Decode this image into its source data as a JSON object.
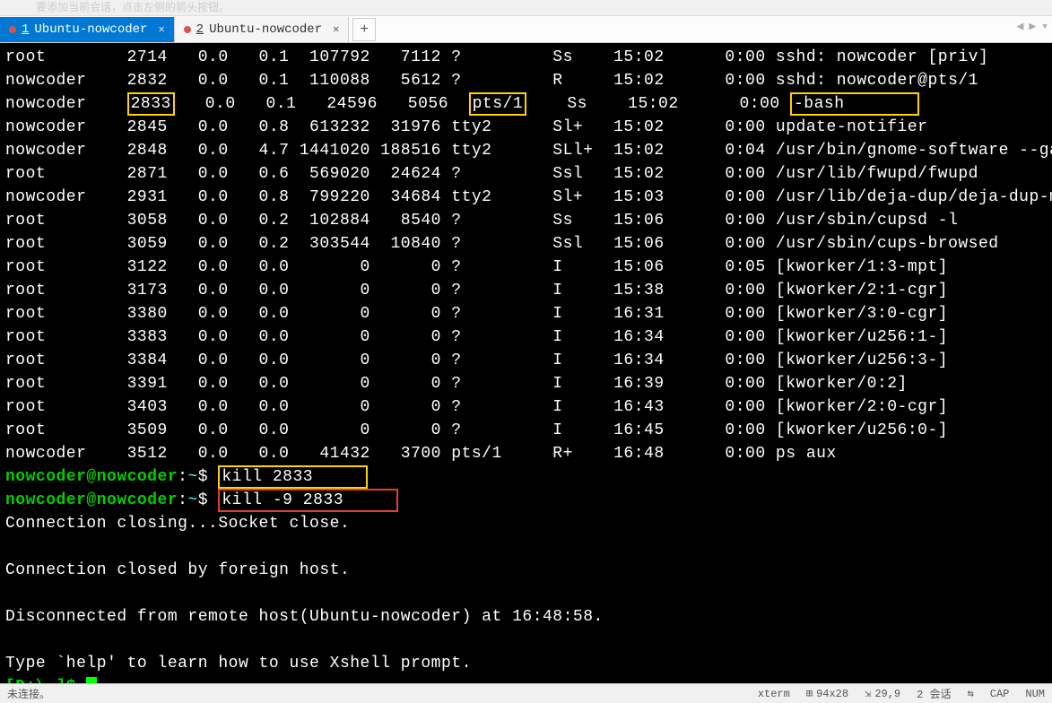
{
  "hint_text": "要添加当前会话，点击左侧的箭头按钮。",
  "tabs": [
    {
      "num": "1",
      "label": "Ubuntu-nowcoder",
      "active": true
    },
    {
      "num": "2",
      "label": "Ubuntu-nowcoder",
      "active": false
    }
  ],
  "addtab": "+",
  "process_rows": [
    {
      "user": "root",
      "pid": "2714",
      "cpu": "0.0",
      "mem": "0.1",
      "vsz": "107792",
      "rss": "7112",
      "tty": "?",
      "stat": "Ss",
      "start": "15:02",
      "time": "0:00",
      "cmd": "sshd: nowcoder [priv]"
    },
    {
      "user": "nowcoder",
      "pid": "2832",
      "cpu": "0.0",
      "mem": "0.1",
      "vsz": "110088",
      "rss": "5612",
      "tty": "?",
      "stat": "R",
      "start": "15:02",
      "time": "0:00",
      "cmd": "sshd: nowcoder@pts/1"
    },
    {
      "user": "nowcoder",
      "pid": "2833",
      "cpu": "0.0",
      "mem": "0.1",
      "vsz": "24596",
      "rss": "5056",
      "tty": "pts/1",
      "stat": "Ss",
      "start": "15:02",
      "time": "0:00",
      "cmd": "-bash",
      "hl_pid": true,
      "hl_tty": true,
      "hl_cmd": true
    },
    {
      "user": "nowcoder",
      "pid": "2845",
      "cpu": "0.0",
      "mem": "0.8",
      "vsz": "613232",
      "rss": "31976",
      "tty": "tty2",
      "stat": "Sl+",
      "start": "15:02",
      "time": "0:00",
      "cmd": "update-notifier"
    },
    {
      "user": "nowcoder",
      "pid": "2848",
      "cpu": "0.0",
      "mem": "4.7",
      "vsz": "1441020",
      "rss": "188516",
      "tty": "tty2",
      "stat": "SLl+",
      "start": "15:02",
      "time": "0:04",
      "cmd": "/usr/bin/gnome-software --ga"
    },
    {
      "user": "root",
      "pid": "2871",
      "cpu": "0.0",
      "mem": "0.6",
      "vsz": "569020",
      "rss": "24624",
      "tty": "?",
      "stat": "Ssl",
      "start": "15:02",
      "time": "0:00",
      "cmd": "/usr/lib/fwupd/fwupd"
    },
    {
      "user": "nowcoder",
      "pid": "2931",
      "cpu": "0.0",
      "mem": "0.8",
      "vsz": "799220",
      "rss": "34684",
      "tty": "tty2",
      "stat": "Sl+",
      "start": "15:03",
      "time": "0:00",
      "cmd": "/usr/lib/deja-dup/deja-dup-m"
    },
    {
      "user": "root",
      "pid": "3058",
      "cpu": "0.0",
      "mem": "0.2",
      "vsz": "102884",
      "rss": "8540",
      "tty": "?",
      "stat": "Ss",
      "start": "15:06",
      "time": "0:00",
      "cmd": "/usr/sbin/cupsd -l"
    },
    {
      "user": "root",
      "pid": "3059",
      "cpu": "0.0",
      "mem": "0.2",
      "vsz": "303544",
      "rss": "10840",
      "tty": "?",
      "stat": "Ssl",
      "start": "15:06",
      "time": "0:00",
      "cmd": "/usr/sbin/cups-browsed"
    },
    {
      "user": "root",
      "pid": "3122",
      "cpu": "0.0",
      "mem": "0.0",
      "vsz": "0",
      "rss": "0",
      "tty": "?",
      "stat": "I",
      "start": "15:06",
      "time": "0:05",
      "cmd": "[kworker/1:3-mpt]"
    },
    {
      "user": "root",
      "pid": "3173",
      "cpu": "0.0",
      "mem": "0.0",
      "vsz": "0",
      "rss": "0",
      "tty": "?",
      "stat": "I",
      "start": "15:38",
      "time": "0:00",
      "cmd": "[kworker/2:1-cgr]"
    },
    {
      "user": "root",
      "pid": "3380",
      "cpu": "0.0",
      "mem": "0.0",
      "vsz": "0",
      "rss": "0",
      "tty": "?",
      "stat": "I",
      "start": "16:31",
      "time": "0:00",
      "cmd": "[kworker/3:0-cgr]"
    },
    {
      "user": "root",
      "pid": "3383",
      "cpu": "0.0",
      "mem": "0.0",
      "vsz": "0",
      "rss": "0",
      "tty": "?",
      "stat": "I",
      "start": "16:34",
      "time": "0:00",
      "cmd": "[kworker/u256:1-]"
    },
    {
      "user": "root",
      "pid": "3384",
      "cpu": "0.0",
      "mem": "0.0",
      "vsz": "0",
      "rss": "0",
      "tty": "?",
      "stat": "I",
      "start": "16:34",
      "time": "0:00",
      "cmd": "[kworker/u256:3-]"
    },
    {
      "user": "root",
      "pid": "3391",
      "cpu": "0.0",
      "mem": "0.0",
      "vsz": "0",
      "rss": "0",
      "tty": "?",
      "stat": "I",
      "start": "16:39",
      "time": "0:00",
      "cmd": "[kworker/0:2]"
    },
    {
      "user": "root",
      "pid": "3403",
      "cpu": "0.0",
      "mem": "0.0",
      "vsz": "0",
      "rss": "0",
      "tty": "?",
      "stat": "I",
      "start": "16:43",
      "time": "0:00",
      "cmd": "[kworker/2:0-cgr]"
    },
    {
      "user": "root",
      "pid": "3509",
      "cpu": "0.0",
      "mem": "0.0",
      "vsz": "0",
      "rss": "0",
      "tty": "?",
      "stat": "I",
      "start": "16:45",
      "time": "0:00",
      "cmd": "[kworker/u256:0-]"
    },
    {
      "user": "nowcoder",
      "pid": "3512",
      "cpu": "0.0",
      "mem": "0.0",
      "vsz": "41432",
      "rss": "3700",
      "tty": "pts/1",
      "stat": "R+",
      "start": "16:48",
      "time": "0:00",
      "cmd": "ps aux"
    }
  ],
  "prompts": [
    {
      "prompt_user": "nowcoder@nowcoder",
      "prompt_path": "~",
      "cmd": "kill 2833",
      "hl": "yellow"
    },
    {
      "prompt_user": "nowcoder@nowcoder",
      "prompt_path": "~",
      "cmd": "kill -9 2833",
      "hl": "red"
    }
  ],
  "closing_lines": [
    "Connection closing...Socket close.",
    "",
    "Connection closed by foreign host.",
    "",
    "Disconnected from remote host(Ubuntu-nowcoder) at 16:48:58.",
    "",
    "Type `help' to learn how to use Xshell prompt."
  ],
  "local_prompt": "[D:\\~]$ ",
  "status": {
    "left": "未连接。",
    "term": "xterm",
    "size": "94x28",
    "pos": "29,9",
    "sessions": "2 会话",
    "cap": "CAP",
    "num": "NUM"
  }
}
